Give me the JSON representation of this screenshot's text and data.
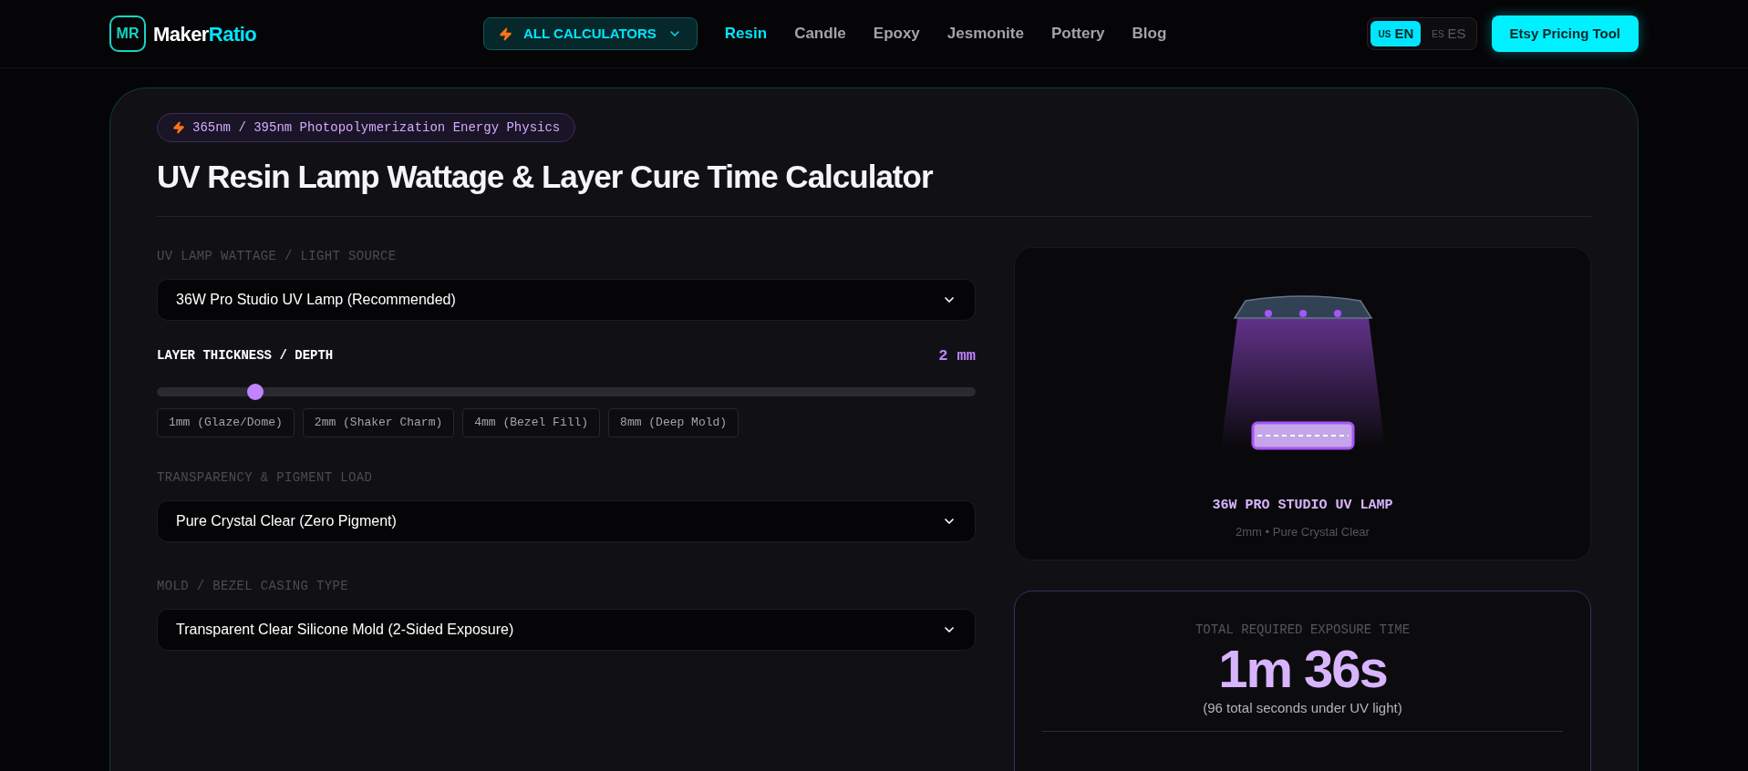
{
  "header": {
    "logo_mark": "MR",
    "brand": "Maker",
    "brand_accent": "Ratio",
    "calculators_button": "ALL CALCULATORS",
    "nav": [
      {
        "label": "Resin",
        "selected": true
      },
      {
        "label": "Candle",
        "selected": false
      },
      {
        "label": "Epoxy",
        "selected": false
      },
      {
        "label": "Jesmonite",
        "selected": false
      },
      {
        "label": "Pottery",
        "selected": false
      },
      {
        "label": "Blog",
        "selected": false
      }
    ],
    "languages": [
      {
        "flag": "US",
        "label": "EN",
        "selected": true
      },
      {
        "flag": "ES",
        "label": "ES",
        "selected": false
      }
    ],
    "cta": "Etsy Pricing Tool"
  },
  "calculator": {
    "badge": "365nm / 395nm Photopolymerization Energy Physics",
    "title": "UV Resin Lamp Wattage & Layer Cure Time Calculator",
    "lamp": {
      "label": "UV LAMP WATTAGE / LIGHT SOURCE",
      "value": "36W Pro Studio UV Lamp (Recommended)"
    },
    "thickness": {
      "label": "LAYER THICKNESS / DEPTH",
      "reading": "2 mm",
      "level": 0.12,
      "presets": [
        "1mm (Glaze/Dome)",
        "2mm (Shaker Charm)",
        "4mm (Bezel Fill)",
        "8mm (Deep Mold)"
      ]
    },
    "transparency": {
      "label": "TRANSPARENCY & PIGMENT LOAD",
      "value": "Pure Crystal Clear (Zero Pigment)"
    },
    "mold": {
      "label": "MOLD / BEZEL CASING TYPE",
      "value": "Transparent Clear Silicone Mold (2-Sided Exposure)"
    },
    "preview": {
      "title": "36W PRO STUDIO UV LAMP",
      "subtitle": "2mm • Pure Crystal Clear"
    },
    "result": {
      "label": "TOTAL REQUIRED EXPOSURE TIME",
      "time": "1m 36s",
      "note": "(96 total seconds under UV light)"
    }
  }
}
